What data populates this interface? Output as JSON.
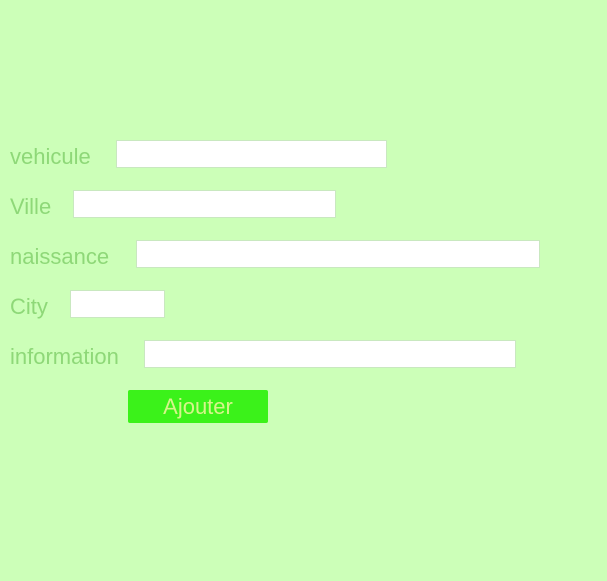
{
  "form": {
    "fields": [
      {
        "label": "vehicule",
        "value": "",
        "placeholder": ""
      },
      {
        "label": "Ville",
        "value": "",
        "placeholder": ""
      },
      {
        "label": "naissance",
        "value": "",
        "placeholder": ""
      },
      {
        "label": "City",
        "value": "",
        "placeholder": ""
      },
      {
        "label": "information",
        "value": "",
        "placeholder": ""
      }
    ],
    "submit_label": "Ajouter"
  },
  "colors": {
    "background": "#ccffb8",
    "label_text": "#8ed878",
    "button_background": "#3bf21a",
    "button_text": "#d6f58a"
  }
}
